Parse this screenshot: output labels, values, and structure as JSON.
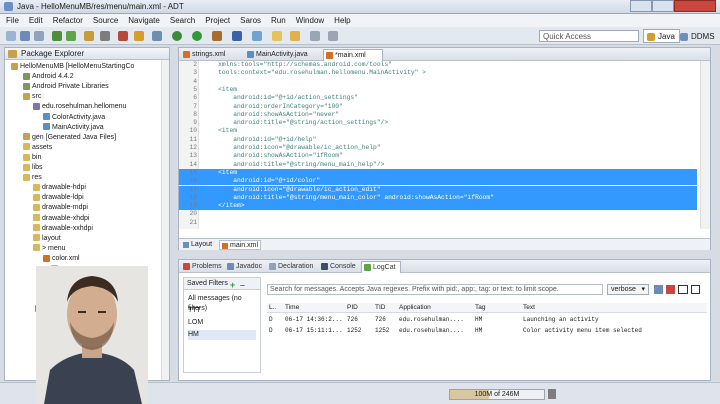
{
  "window": {
    "title": "Java - HelloMenuMB/res/menu/main.xml - ADT"
  },
  "menubar": [
    "File",
    "Edit",
    "Refactor",
    "Source",
    "Navigate",
    "Search",
    "Project",
    "Saros",
    "Run",
    "Window",
    "Help"
  ],
  "toolbar": {
    "quick_access_placeholder": "Quick Access",
    "perspective_java": "Java",
    "perspective_ddms": "DDMS"
  },
  "package_explorer": {
    "title": "Package Explorer",
    "tree": [
      "HelloMenuMB [HelloMenuStartingCo",
      "Android 4.4.2",
      "Android Private Libraries",
      "src",
      "edu.rosehulman.hellomenu",
      "ColorActivity.java",
      "MainActivity.java",
      "gen [Generated Java Files]",
      "assets",
      "bin",
      "libs",
      "res",
      "drawable-hdpi",
      "drawable-ldpi",
      "drawable-mdpi",
      "drawable-xhdpi",
      "drawable-xxhdpi",
      "layout",
      "> menu",
      "color.xml",
      "va",
      "va",
      "valu",
      "valu",
      "Androi"
    ]
  },
  "editor": {
    "tabs": [
      "strings.xml",
      "MainActivity.java",
      "*main.xml"
    ],
    "lines": [
      {
        "n": "2",
        "text": "    xmlns:tools=\"http://schemas.android.com/tools\""
      },
      {
        "n": "3",
        "text": "    tools:context=\"edu.rosehulman.hellomenu.MainActivity\" >"
      },
      {
        "n": "4",
        "text": ""
      },
      {
        "n": "5",
        "text": "    <item"
      },
      {
        "n": "6",
        "text": "        android:id=\"@+id/action_settings\""
      },
      {
        "n": "7",
        "text": "        android:orderInCategory=\"100\""
      },
      {
        "n": "8",
        "text": "        android:showAsAction=\"never\""
      },
      {
        "n": "9",
        "text": "        android:title=\"@string/action_settings\"/>"
      },
      {
        "n": "10",
        "text": "    <item"
      },
      {
        "n": "11",
        "text": "        android:id=\"@+id/help\""
      },
      {
        "n": "12",
        "text": "        android:icon=\"@drawable/ic_action_help\""
      },
      {
        "n": "13",
        "text": "        android:showAsAction=\"ifRoom\""
      },
      {
        "n": "14",
        "text": "        android:title=\"@string/menu_main_help\"/>"
      },
      {
        "n": "15",
        "text": "    <item"
      },
      {
        "n": "16",
        "text": "        android:id=\"@+id/color\""
      },
      {
        "n": "17",
        "text": "        android:icon=\"@drawable/ic_action_edit\""
      },
      {
        "n": "18",
        "text": "        android:title=\"@string/menu_main_color\" android:showAsAction=\"ifRoom\""
      },
      {
        "n": "19",
        "text": "    </item>"
      },
      {
        "n": "20",
        "text": ""
      },
      {
        "n": "21",
        "text": ""
      }
    ],
    "selected_lines": [
      "15",
      "16",
      "17",
      "18",
      "19"
    ],
    "bottom_tabs": [
      "Layout",
      "main.xml"
    ]
  },
  "bottom_panel": {
    "tabs": [
      "Problems",
      "Javadoc",
      "Declaration",
      "Console",
      "LogCat"
    ],
    "saved_filters_title": "Saved Filters",
    "filters": [
      "All messages (no filters)",
      "TTT",
      "LOM",
      "HM"
    ],
    "search_placeholder": "Search for messages. Accepts Java regexes. Prefix with pid:, app:, tag: or text: to limit scope.",
    "verbose": "verbose",
    "log_columns": [
      "L..",
      "Time",
      "PID",
      "TID",
      "Application",
      "Tag",
      "Text"
    ],
    "log_rows": [
      [
        "D",
        "06-17 14:36:2...",
        "726",
        "726",
        "edu.rosehulman....",
        "HM",
        "Launching an activity"
      ],
      [
        "D",
        "06-17 15:11:1...",
        "1252",
        "1252",
        "edu.rosehulman....",
        "HM",
        "Color activity menu item selected"
      ]
    ]
  },
  "status": {
    "memory": "100M of 246M",
    "memory_fraction": 0.41
  },
  "colors": {
    "selection": "#3399ff",
    "keyword": "#3f7f7f",
    "attr": "#7f007f",
    "value": "#2a00ff"
  }
}
